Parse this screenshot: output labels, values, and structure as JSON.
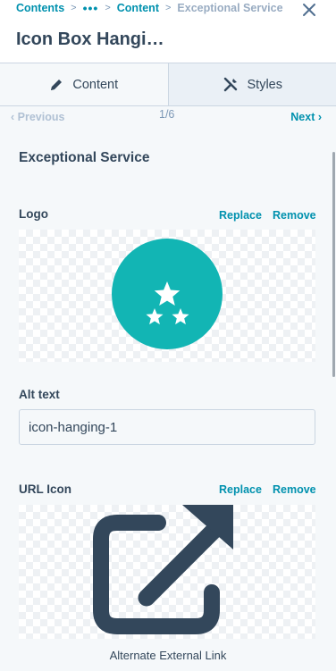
{
  "header": {
    "breadcrumb": {
      "root": "Contents",
      "ellipsis": "•••",
      "content": "Content",
      "current": "Exceptional Service",
      "separator": ">"
    },
    "title": "Icon Box Hangi…"
  },
  "tabs": [
    {
      "label": "Content",
      "icon": "pencil-icon",
      "active": true
    },
    {
      "label": "Styles",
      "icon": "styles-brush-icon",
      "active": false
    }
  ],
  "pager": {
    "previous": "‹ Previous",
    "count": "1/6",
    "next": "Next ›"
  },
  "section": {
    "title": "Exceptional Service"
  },
  "logo": {
    "label": "Logo",
    "replace": "Replace",
    "remove": "Remove",
    "icon": "three-stars-icon",
    "circle_color": "#12b5b4"
  },
  "alt_text": {
    "label": "Alt text",
    "value": "icon-hanging-1"
  },
  "url_icon": {
    "label": "URL Icon",
    "replace": "Replace",
    "remove": "Remove",
    "icon": "external-link-icon",
    "icon_color": "#33475b",
    "caption": "Alternate External Link"
  },
  "colors": {
    "accent": "#0091ae",
    "text": "#33475b",
    "muted": "#99acc2"
  }
}
